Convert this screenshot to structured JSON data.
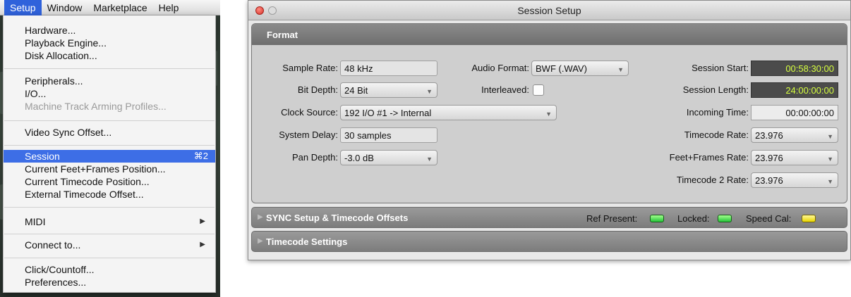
{
  "menubar": {
    "items": [
      "Setup",
      "Window",
      "Marketplace",
      "Help"
    ]
  },
  "setup_menu": {
    "items": [
      {
        "label": "Hardware..."
      },
      {
        "label": "Playback Engine..."
      },
      {
        "label": "Disk Allocation..."
      },
      {
        "label": "Peripherals..."
      },
      {
        "label": "I/O..."
      },
      {
        "label": "Machine Track Arming Profiles...",
        "disabled": true
      },
      {
        "label": "Video Sync Offset..."
      },
      {
        "label": "Session",
        "shortcut": "⌘2",
        "selected": true
      },
      {
        "label": "Current Feet+Frames Position..."
      },
      {
        "label": "Current Timecode Position..."
      },
      {
        "label": "External Timecode Offset..."
      },
      {
        "label": "MIDI",
        "submenu": true
      },
      {
        "label": "Connect to...",
        "submenu": true
      },
      {
        "label": "Click/Countoff..."
      },
      {
        "label": "Preferences..."
      }
    ]
  },
  "window": {
    "title": "Session Setup",
    "format": {
      "header": "Format",
      "sample_rate_label": "Sample Rate:",
      "sample_rate": "48 kHz",
      "bit_depth_label": "Bit Depth:",
      "bit_depth": "24 Bit",
      "clock_source_label": "Clock Source:",
      "clock_source": "192 I/O #1 -> Internal",
      "system_delay_label": "System Delay:",
      "system_delay": "30 samples",
      "pan_depth_label": "Pan Depth:",
      "pan_depth": "-3.0 dB",
      "audio_format_label": "Audio Format:",
      "audio_format": "BWF (.WAV)",
      "interleaved_label": "Interleaved:",
      "interleaved_checked": false,
      "session_start_label": "Session Start:",
      "session_start": "00:58:30:00",
      "session_length_label": "Session Length:",
      "session_length": "24:00:00:00",
      "incoming_time_label": "Incoming Time:",
      "incoming_time": "00:00:00:00",
      "timecode_rate_label": "Timecode Rate:",
      "timecode_rate": "23.976",
      "feet_frames_rate_label": "Feet+Frames Rate:",
      "feet_frames_rate": "23.976",
      "timecode2_rate_label": "Timecode 2 Rate:",
      "timecode2_rate": "23.976"
    },
    "sync": {
      "header": "SYNC Setup & Timecode Offsets",
      "ref_present_label": "Ref Present:",
      "locked_label": "Locked:",
      "speed_cal_label": "Speed Cal:"
    },
    "timecode_settings": {
      "header": "Timecode Settings"
    }
  },
  "colors": {
    "menu_highlight": "#3d6ee6",
    "timecode_text": "#d6ff3f",
    "led_green": "#26c43a",
    "led_yellow": "#e8d500"
  }
}
